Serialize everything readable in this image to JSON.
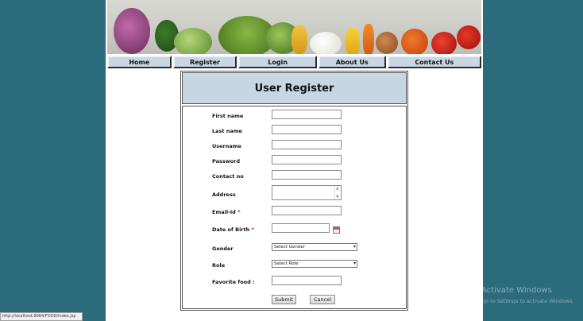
{
  "nav": {
    "items": [
      "Home",
      "Register",
      "Login",
      "About Us",
      "Contact Us"
    ]
  },
  "form": {
    "title": "User Register",
    "fields": {
      "first_name": "First name",
      "last_name": "Last name",
      "username": "Username",
      "password": "Password",
      "contact": "Contact no",
      "address": "Address",
      "email": "Email-Id",
      "dob": "Date of Birth",
      "gender": "Gender",
      "role": "Role",
      "favorite_food": "Favorite food :"
    },
    "required_marker": "*",
    "gender_selected": "Select Gender",
    "role_selected": "Select Role",
    "submit_label": "Submit",
    "cancel_label": "Cancel"
  },
  "status_bar": "http://localhost:8084/FOOD/index.jsp",
  "watermark": {
    "title": "Activate Windows",
    "subtitle": "Go to Settings to activate Windows."
  },
  "colors": {
    "background": "#2b6b7c",
    "nav": "#c9d7e4",
    "title_bar": "#c7d6e3"
  }
}
